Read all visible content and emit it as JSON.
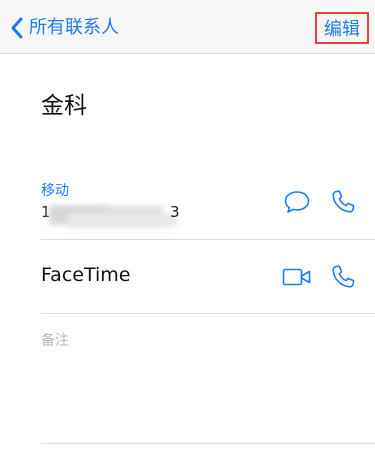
{
  "nav": {
    "back_label": "所有联系人",
    "edit_label": "编辑"
  },
  "contact": {
    "name": "金科"
  },
  "phone": {
    "label": "移动",
    "value_start": "1",
    "value_end": "3"
  },
  "facetime": {
    "label": "FaceTime"
  },
  "notes": {
    "label": "备注"
  },
  "icons": {
    "back": "chevron-left-icon",
    "message": "message-bubble-icon",
    "call": "phone-icon",
    "video": "video-camera-icon"
  },
  "colors": {
    "accent": "#1a7cf5",
    "highlight_box": "#e8413a",
    "separator": "#dcdcdc",
    "notes_label": "#b8b8b8"
  }
}
